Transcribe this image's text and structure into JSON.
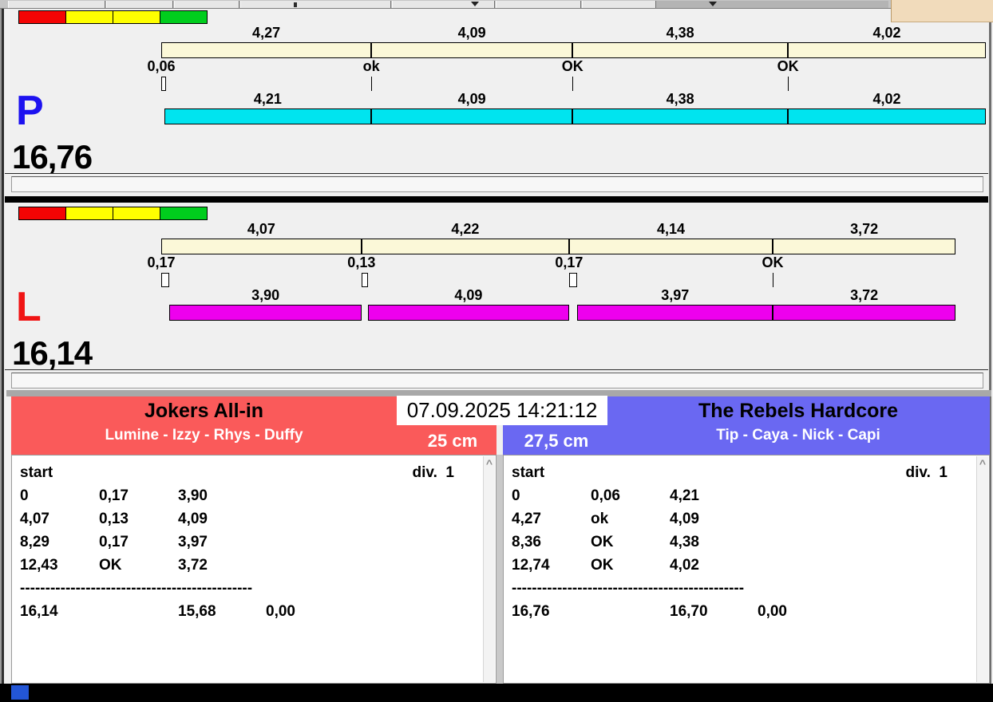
{
  "ui": {
    "timestamp": "07.09.2025 14:21:12",
    "scroll_up_icon": "^",
    "colors": {
      "cream_bar": "#fbf8d8",
      "panel_p_bar": "#00e4ef",
      "panel_l_bar": "#ee00ee",
      "team_left_header": "#fa5a5a",
      "team_right_header": "#6a68f2",
      "traffic": [
        "#f40404",
        "#ffff00",
        "#ffff00",
        "#00cd1d"
      ],
      "bottom_square": "#2356d6"
    }
  },
  "panels": [
    {
      "letter": "P",
      "letter_color": "#1d12f0",
      "total": "16,76",
      "bar_color": "#00e4ef",
      "segments": [
        {
          "cum_label": "4,27",
          "cum": 4.27,
          "marker": "0,06",
          "gap": 0.06,
          "throw_label": "4,21",
          "throw": 4.21
        },
        {
          "cum_label": "4,09",
          "cum": 4.09,
          "marker": "ok",
          "gap": 0,
          "throw_label": "4,09",
          "throw": 4.09
        },
        {
          "cum_label": "4,38",
          "cum": 4.38,
          "marker": "OK",
          "gap": 0,
          "throw_label": "4,38",
          "throw": 4.38
        },
        {
          "cum_label": "4,02",
          "cum": 4.02,
          "marker": "OK",
          "gap": 0,
          "throw_label": "4,02",
          "throw": 4.02
        }
      ]
    },
    {
      "letter": "L",
      "letter_color": "#f01414",
      "total": "16,14",
      "bar_color": "#ee00ee",
      "segments": [
        {
          "cum_label": "4,07",
          "cum": 4.07,
          "marker": "0,17",
          "gap": 0.17,
          "throw_label": "3,90",
          "throw": 3.9
        },
        {
          "cum_label": "4,22",
          "cum": 4.22,
          "marker": "0,13",
          "gap": 0.13,
          "throw_label": "4,09",
          "throw": 4.09
        },
        {
          "cum_label": "4,14",
          "cum": 4.14,
          "marker": "0,17",
          "gap": 0.17,
          "throw_label": "3,97",
          "throw": 3.97
        },
        {
          "cum_label": "3,72",
          "cum": 3.72,
          "marker": "OK",
          "gap": 0,
          "throw_label": "3,72",
          "throw": 3.72
        }
      ]
    }
  ],
  "teams": [
    {
      "name": "Jokers All-in",
      "players": "Lumine - Izzy - Rhys - Duffy",
      "distance": "25 cm",
      "header_color": "#fa5a5a",
      "list": {
        "start_label": "start",
        "div_label": "div.  1",
        "rows": [
          [
            "0",
            "0,17",
            "3,90"
          ],
          [
            "4,07",
            "0,13",
            "4,09"
          ],
          [
            "8,29",
            "0,17",
            "3,97"
          ],
          [
            "12,43",
            "OK",
            "3,72"
          ]
        ],
        "separator": "----------------------------------------------",
        "totals": [
          "16,14",
          "15,68",
          "0,00"
        ]
      }
    },
    {
      "name": "The Rebels Hardcore",
      "players": "Tip - Caya - Nick - Capi",
      "distance": "27,5 cm",
      "header_color": "#6a68f2",
      "list": {
        "start_label": "start",
        "div_label": "div.  1",
        "rows": [
          [
            "0",
            "0,06",
            "4,21"
          ],
          [
            "4,27",
            "ok",
            "4,09"
          ],
          [
            "8,36",
            "OK",
            "4,38"
          ],
          [
            "12,74",
            "OK",
            "4,02"
          ]
        ],
        "separator": "----------------------------------------------",
        "totals": [
          "16,76",
          "16,70",
          "0,00"
        ]
      }
    }
  ]
}
